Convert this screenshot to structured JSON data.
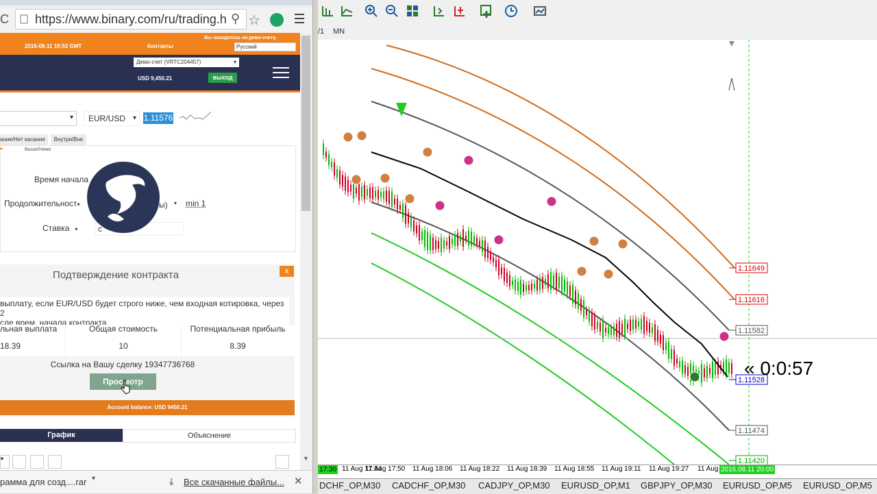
{
  "browser": {
    "url": "https://www.binary.com/ru/trading.h",
    "download_file": "рамма для созд....rar",
    "all_downloads": "Все скачанные файлы..."
  },
  "site": {
    "datetime": "2016-08-11 16:53 GMT",
    "contacts": "Контакты",
    "demo_notice": "Вы находитесь на демо-счету.",
    "language": "Русский",
    "account_select": "Демо-счет (VRTC204457)",
    "balance": "USD 9,450.21",
    "logout": "выход",
    "symbol": "EUR/USD",
    "price": "1.11576",
    "tabs": [
      "ание/Нет касания",
      "Внутри/Вне"
    ],
    "subtab": "Выше/Ниже",
    "start_time_label": "Время начала",
    "duration_label": "Продолжительност",
    "duration_unit": "ы)",
    "duration_min": "min 1",
    "stake_label": "Ставка",
    "stake_value": "с",
    "confirm_title": "Подтверждение контракта",
    "close_x": "x",
    "confirm_text_line1": "выплату, если EUR/USD будет строго ниже, чем входная котировка, через 2",
    "confirm_text_line2": "сле врем. начала контракта.",
    "payout_label": "льная выплата",
    "payout_value": "18.39",
    "total_cost_label": "Общая стоимость",
    "total_cost_value": "10",
    "potential_profit_label": "Потенциальная прибыль",
    "potential_profit_value": "8.39",
    "deal_link": "Ссылка на Вашу сделку 19347736768",
    "view_button": "Просмотр",
    "account_balance": "Account balance: USD 9450.21",
    "bottom_tab_active": "График",
    "bottom_tab_inactive": "Объяснение"
  },
  "mt4": {
    "timeframe": "MN",
    "timeframe_prefix": "/1",
    "countdown": "« 0:0:57",
    "price_levels": [
      {
        "label": "1.11649",
        "color": "#e00000"
      },
      {
        "label": "1.11616",
        "color": "#e00000"
      },
      {
        "label": "1.11582",
        "color": "#555555"
      },
      {
        "label": "1.11528",
        "color": "#0000cc"
      },
      {
        "label": "1.11474",
        "color": "#555555"
      },
      {
        "label": "1.11420",
        "color": "#00aa00"
      }
    ],
    "time_labels": [
      "17:30",
      "11 Aug 17:34",
      "11 Aug 17:50",
      "11 Aug 18:06",
      "11 Aug 18:22",
      "11 Aug 18:39",
      "11 Aug 18:55",
      "11 Aug 19:11",
      "11 Aug 19:27",
      "11 Aug",
      "2016.08.11 20:00"
    ],
    "symbol_tabs": [
      "DCHF_OP,M30",
      "CADCHF_OP,M30",
      "CADJPY_OP,M30",
      "EURUSD_OP,M1",
      "GBPJPY_OP,M30",
      "EURUSD_OP,M5",
      "EURUSD_OP,M5"
    ],
    "colors": {
      "bull": "#00bb00",
      "bear": "#cc0022",
      "orange_band": "#d06a1a",
      "gray_band": "#555555",
      "green_band": "#22cc22"
    }
  }
}
